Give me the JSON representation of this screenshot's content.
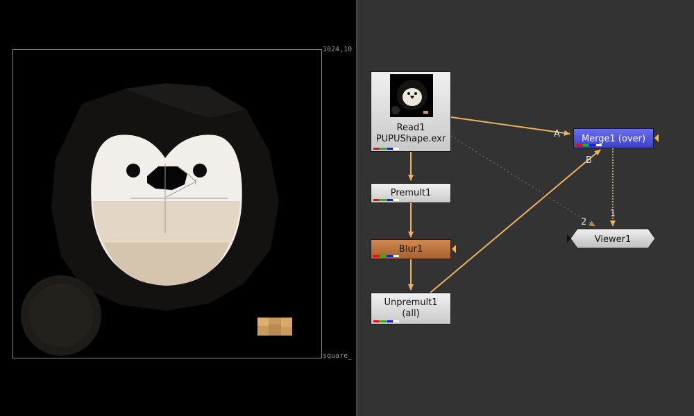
{
  "viewer": {
    "format_top_right": "1024,10",
    "format_bottom_right": "square_"
  },
  "nodes": {
    "read": {
      "name": "Read1",
      "file": "PUPUShape.exr"
    },
    "premult": {
      "name": "Premult1"
    },
    "blur": {
      "name": "Blur1"
    },
    "unpremult": {
      "name": "Unpremult1",
      "channels": "(all)"
    },
    "merge": {
      "name": "Merge1 (over)"
    },
    "viewer": {
      "name": "Viewer1"
    }
  },
  "inputs": {
    "a": "A",
    "b": "B",
    "one": "1",
    "two": "2"
  },
  "colors": {
    "graph_bg": "#333333",
    "pipe": "#f0b35a",
    "blur_node": "#b8703a",
    "merge_node": "#4a50dc",
    "channel_red": "#e01010",
    "channel_green": "#10c010",
    "channel_blue": "#1020e0",
    "channel_alpha": "#ffffff"
  }
}
